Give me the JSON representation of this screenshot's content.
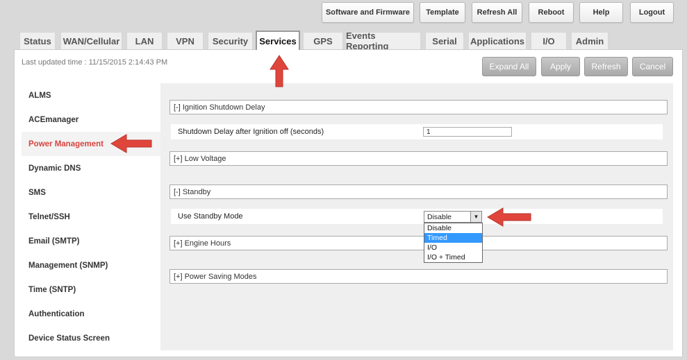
{
  "toolbar": {
    "software_firmware": "Software and Firmware",
    "template": "Template",
    "refresh_all": "Refresh All",
    "reboot": "Reboot",
    "help": "Help",
    "logout": "Logout"
  },
  "tabs": [
    "Status",
    "WAN/Cellular",
    "LAN",
    "VPN",
    "Security",
    "Services",
    "GPS",
    "Events Reporting",
    "Serial",
    "Applications",
    "I/O",
    "Admin"
  ],
  "last_updated": "Last updated time : 11/15/2015 2:14:43 PM",
  "actions": {
    "expand_all": "Expand All",
    "apply": "Apply",
    "refresh": "Refresh",
    "cancel": "Cancel"
  },
  "sidebar": [
    "ALMS",
    "ACEmanager",
    "Power Management",
    "Dynamic DNS",
    "SMS",
    "Telnet/SSH",
    "Email (SMTP)",
    "Management (SNMP)",
    "Time (SNTP)",
    "Authentication",
    "Device Status Screen"
  ],
  "sections": {
    "ignition": "[-] Ignition Shutdown Delay",
    "low_voltage": "[+] Low Voltage",
    "standby": "[-] Standby",
    "engine_hours": "[+] Engine Hours",
    "power_saving": "[+] Power Saving Modes"
  },
  "fields": {
    "shutdown_delay_label": "Shutdown Delay after Ignition off (seconds)",
    "shutdown_delay_value": "1",
    "standby_label": "Use Standby Mode",
    "standby_value": "Disable"
  },
  "standby_options": [
    "Disable",
    "Timed",
    "I/O",
    "I/O + Timed"
  ],
  "colors": {
    "accent_red": "#d64540",
    "highlight_blue": "#3399ff"
  }
}
